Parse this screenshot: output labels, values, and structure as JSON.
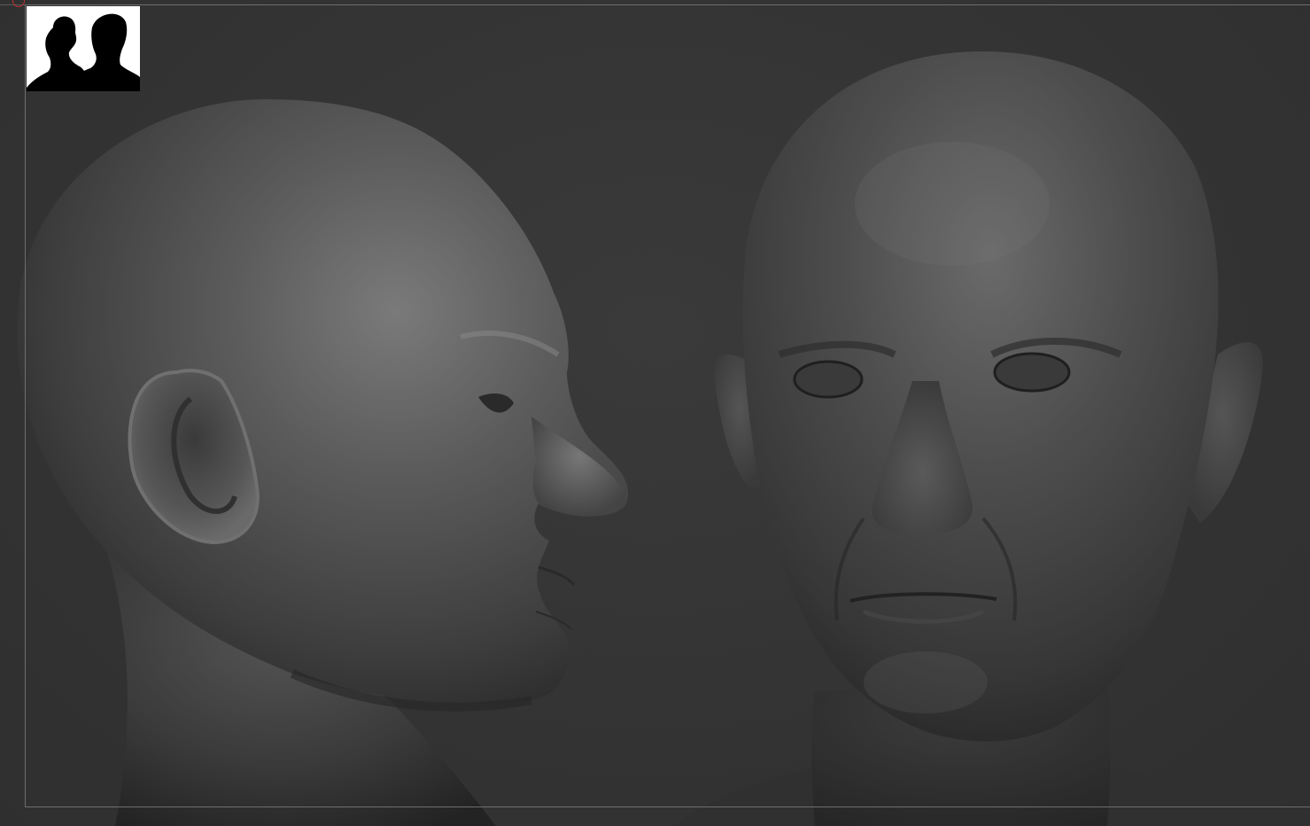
{
  "viewport": {
    "background": "#343434",
    "frame_color": "#6e6e6e"
  },
  "thumbnail": {
    "icon": "head-silhouettes-icon",
    "background": "#ffffff",
    "silhouette_color": "#000000"
  },
  "models": [
    {
      "name": "side-profile-head",
      "view": "side"
    },
    {
      "name": "front-head",
      "view": "front"
    }
  ]
}
